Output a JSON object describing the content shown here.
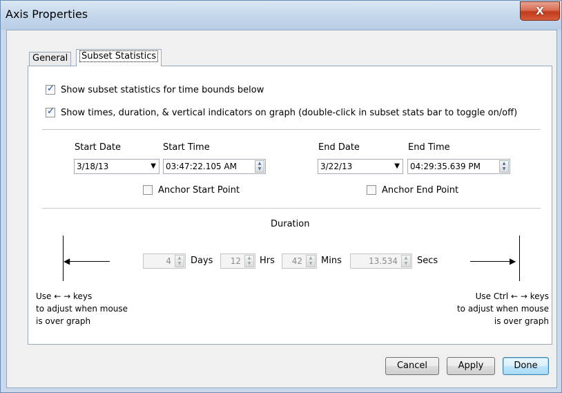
{
  "window": {
    "title": "Axis Properties",
    "close_glyph": "X"
  },
  "tabs": [
    {
      "label": "General",
      "selected": false
    },
    {
      "label": "Subset Statistics",
      "selected": true
    }
  ],
  "options": {
    "show_stats_label": "Show subset statistics for time bounds below",
    "show_stats_checked": true,
    "show_times_label": "Show times, duration, & vertical indicators on graph (double-click in subset stats bar to toggle on/off)",
    "show_times_checked": true
  },
  "start": {
    "date_label": "Start Date",
    "date_value": "3/18/13",
    "time_label": "Start Time",
    "time_value": "03:47:22.105 AM",
    "anchor_label": "Anchor Start Point",
    "anchor_checked": false
  },
  "end": {
    "date_label": "End Date",
    "date_value": "3/22/13",
    "time_label": "End Time",
    "time_value": "04:29:35.639 PM",
    "anchor_label": "Anchor End Point",
    "anchor_checked": false
  },
  "duration": {
    "title": "Duration",
    "days_value": "4",
    "days_label": "Days",
    "hrs_value": "12",
    "hrs_label": "Hrs",
    "mins_value": "42",
    "mins_label": "Mins",
    "secs_value": "13.534",
    "secs_label": "Secs"
  },
  "hints": {
    "left_line1": "Use ← → keys",
    "left_line2": "to adjust when mouse",
    "left_line3": "is over graph",
    "right_line1": "Use Ctrl ← → keys",
    "right_line2": "to adjust when mouse",
    "right_line3": "is over graph"
  },
  "buttons": {
    "cancel": "Cancel",
    "apply": "Apply",
    "done": "Done"
  },
  "icons": {
    "dropdown": "chevron-down-icon",
    "spinner": "spinner-icon",
    "close": "close-icon"
  }
}
